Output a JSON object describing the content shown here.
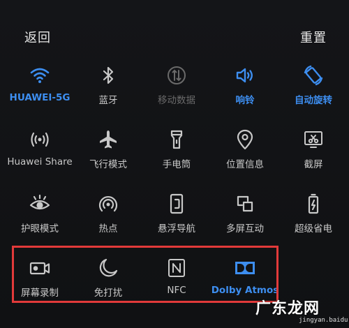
{
  "header": {
    "back_label": "返回",
    "reset_label": "重置"
  },
  "colors": {
    "active": "#3d8ef0",
    "inactive": "#c8c8c8",
    "disabled": "#6a6a6a",
    "highlight_box": "#e23a3a"
  },
  "tiles": [
    {
      "label": "HUAWEI-5G",
      "icon": "wifi-icon",
      "state": "active"
    },
    {
      "label": "蓝牙",
      "icon": "bluetooth-icon",
      "state": "inactive"
    },
    {
      "label": "移动数据",
      "icon": "mobile-data-icon",
      "state": "disabled"
    },
    {
      "label": "响铃",
      "icon": "ring-icon",
      "state": "active"
    },
    {
      "label": "自动旋转",
      "icon": "auto-rotate-icon",
      "state": "active"
    },
    {
      "label": "Huawei Share",
      "icon": "huawei-share-icon",
      "state": "inactive"
    },
    {
      "label": "飞行模式",
      "icon": "airplane-icon",
      "state": "inactive"
    },
    {
      "label": "手电筒",
      "icon": "flashlight-icon",
      "state": "inactive"
    },
    {
      "label": "位置信息",
      "icon": "location-icon",
      "state": "inactive"
    },
    {
      "label": "截屏",
      "icon": "screenshot-icon",
      "state": "inactive"
    },
    {
      "label": "护眼模式",
      "icon": "eye-comfort-icon",
      "state": "inactive"
    },
    {
      "label": "热点",
      "icon": "hotspot-icon",
      "state": "inactive"
    },
    {
      "label": "悬浮导航",
      "icon": "floating-nav-icon",
      "state": "inactive"
    },
    {
      "label": "多屏互动",
      "icon": "multi-screen-icon",
      "state": "inactive"
    },
    {
      "label": "超级省电",
      "icon": "battery-saver-icon",
      "state": "inactive"
    },
    {
      "label": "屏幕录制",
      "icon": "screen-record-icon",
      "state": "inactive"
    },
    {
      "label": "免打扰",
      "icon": "do-not-disturb-icon",
      "state": "inactive"
    },
    {
      "label": "NFC",
      "icon": "nfc-icon",
      "state": "inactive"
    },
    {
      "label": "Dolby Atmos",
      "icon": "dolby-icon",
      "state": "active"
    }
  ],
  "watermark": {
    "title": "广东龙网",
    "url": "jingyan.baidu.com"
  }
}
